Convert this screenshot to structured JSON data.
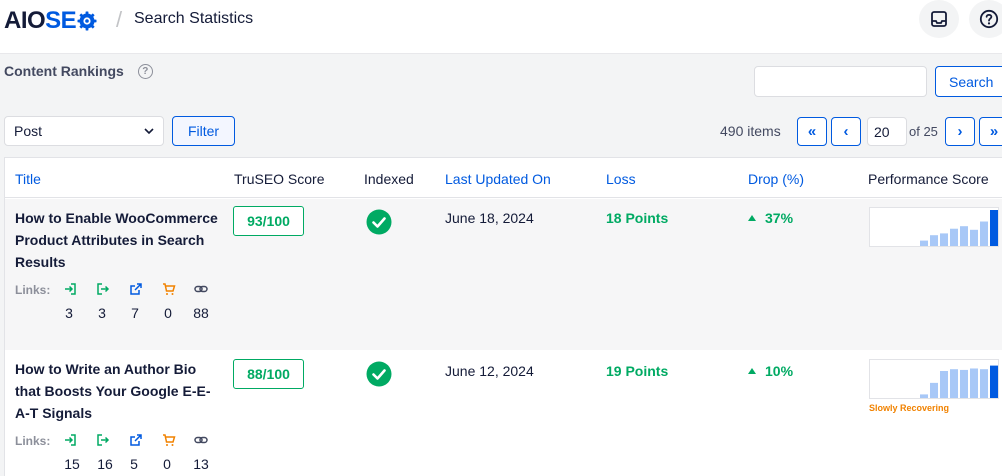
{
  "header": {
    "logo_text_dark": "AIO",
    "logo_text_blue": "SE",
    "separator": "/",
    "page_title": "Search Statistics",
    "inbox_icon": "inbox-icon",
    "help_icon": "question-circle-icon"
  },
  "section": {
    "title": "Content Rankings",
    "help": "?"
  },
  "search": {
    "placeholder": "",
    "value": "",
    "button_label": "Search"
  },
  "filter": {
    "post_type_selected": "Post",
    "button_label": "Filter"
  },
  "pagination": {
    "items_label": "490 items",
    "first": "«",
    "prev": "‹",
    "current_page": "20",
    "of_label": "of 25",
    "next": "›",
    "last": "»"
  },
  "table": {
    "columns": [
      "Title",
      "TruSEO Score",
      "Indexed",
      "Last Updated On",
      "Loss",
      "Drop (%)",
      "Performance Score"
    ],
    "links_label": "Links:",
    "rows": [
      {
        "title": "How to Enable WooCommerce Product Attributes in Search Results",
        "links": [
          "3",
          "3",
          "7",
          "0",
          "88"
        ],
        "score": "93/100",
        "indexed": "indexed-check-icon",
        "date": "June 18, 2024",
        "loss": "18 Points",
        "drop": "37%",
        "performance": [
          0.15,
          0.3,
          0.35,
          0.48,
          0.55,
          0.45,
          0.68,
          1.0
        ],
        "performance_label": ""
      },
      {
        "title": "How to Write an Author Bio that Boosts Your Google E-E-A-T Signals",
        "links": [
          "15",
          "16",
          "5",
          "0",
          "13"
        ],
        "score": "88/100",
        "indexed": "indexed-check-icon",
        "date": "June 12, 2024",
        "loss": "19 Points",
        "drop": "10%",
        "performance": [
          0.1,
          0.42,
          0.75,
          0.8,
          0.78,
          0.82,
          0.8,
          0.9
        ],
        "performance_label": "Slowly Recovering"
      }
    ]
  },
  "colors": {
    "accent_blue": "#005ae0",
    "success_green": "#00aa63",
    "warning_orange": "#f18200",
    "bar_light": "#a8c8f7",
    "bar_dark": "#005ae0"
  }
}
